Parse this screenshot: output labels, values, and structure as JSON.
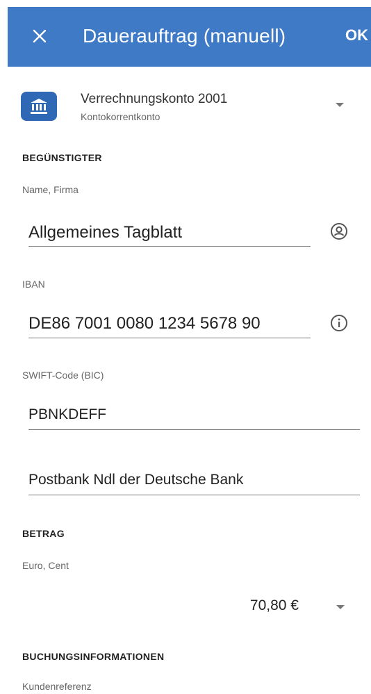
{
  "app_bar": {
    "title": "Dauerauftrag (manuell)",
    "ok_label": "OK",
    "close_icon": "close-icon",
    "background": "#3f7ac6"
  },
  "account": {
    "name": "Verrechnungskonto 2001",
    "type": "Kontokorrentkonto",
    "icon": "bank-icon"
  },
  "beneficiary": {
    "heading": "BEGÜNSTIGTER",
    "name_label": "Name, Firma",
    "name_value": "Allgemeines Tagblatt",
    "name_icon": "contact-icon",
    "iban_label": "IBAN",
    "iban_value": "DE86 7001 0080 1234 5678 90",
    "iban_icon": "info-icon",
    "bic_label": "SWIFT-Code (BIC)",
    "bic_value": "PBNKDEFF",
    "bank_name": "Postbank Ndl der Deutsche Bank"
  },
  "amount": {
    "heading": "BETRAG",
    "label": "Euro, Cent",
    "value": "70,80 €"
  },
  "booking": {
    "heading": "BUCHUNGSINFORMATIONEN",
    "reference_label": "Kundenreferenz"
  }
}
